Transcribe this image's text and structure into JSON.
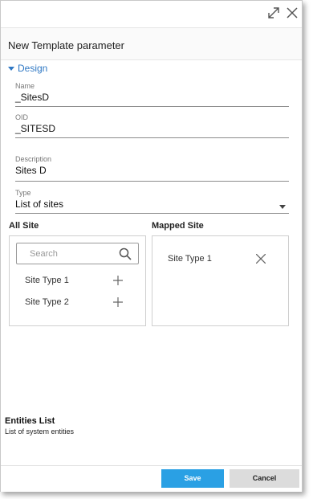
{
  "dialog": {
    "title": "New Template parameter",
    "icons": {
      "expand": "expand-icon",
      "close": "close-icon"
    }
  },
  "section": {
    "label": "Design"
  },
  "fields": {
    "name": {
      "label": "Name",
      "value": "_SitesD"
    },
    "oid": {
      "label": "OID",
      "value": "_SITESD"
    },
    "description": {
      "label": "Description",
      "value": "Sites D"
    },
    "type": {
      "label": "Type",
      "value": "List of sites"
    }
  },
  "all_site": {
    "title": "All Site",
    "search_placeholder": "Search",
    "items": [
      {
        "label": "Site Type 1"
      },
      {
        "label": "Site Type 2"
      }
    ]
  },
  "mapped_site": {
    "title": "Mapped Site",
    "items": [
      {
        "label": "Site Type 1"
      }
    ]
  },
  "entities": {
    "title": "Entities List",
    "subtitle": "List of system entities"
  },
  "footer": {
    "save_label": "Save",
    "cancel_label": "Cancel"
  },
  "colors": {
    "accent": "#2f78c4",
    "save_button": "#2aa0e4",
    "cancel_button": "#dcdcdc"
  }
}
